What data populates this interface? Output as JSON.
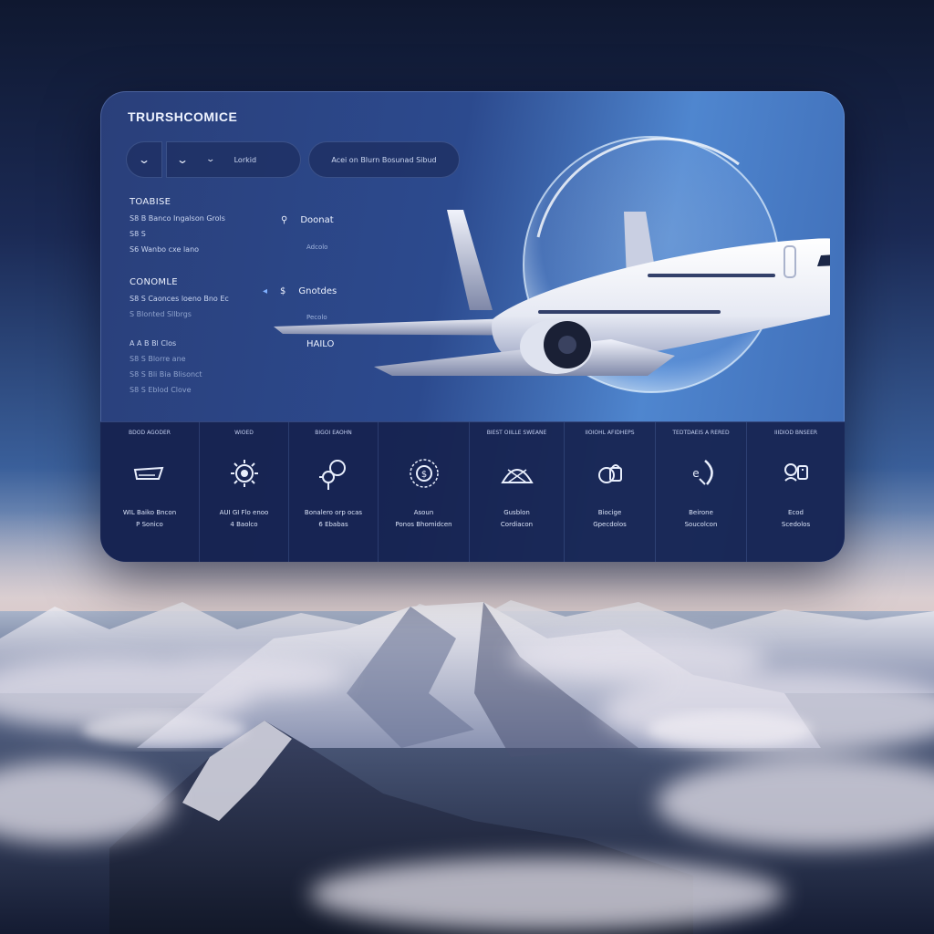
{
  "app": {
    "title": "TRURSHCOMICE"
  },
  "toolbar": {
    "chevrons": [
      "chevron-down-icon",
      "chevron-down-icon",
      "chevron-down-icon"
    ],
    "segment_label": "Lorkid",
    "search_text": "Acei on Blurn Bosunad Sibud"
  },
  "left": {
    "section1": {
      "title": "TOABISE",
      "rows": [
        "S8 B  Banco Ingalson Grols",
        "S8 S",
        "S6 Wanbo cxe lano"
      ]
    },
    "section2": {
      "title": "CONOMLE",
      "rows": [
        "S8 S  Caonces loeno Bno Ec",
        "S  Blonted Sllbrgs"
      ]
    },
    "section3": {
      "rows": [
        "A A B  Bl Clos",
        "S8 S  Blorre ane",
        "S8 S  Bli Bia Blisonct",
        "S8 S  Eblod Clove"
      ]
    }
  },
  "middle": {
    "items": [
      {
        "icon": "pin-icon",
        "label": "Doonat",
        "sub": "Adcolo"
      },
      {
        "icon": "s-icon",
        "label": "Gnotdes",
        "sub": "Pecolo"
      },
      {
        "icon": "slash-icon",
        "label": "HAILO",
        "sub": ""
      }
    ]
  },
  "cards": [
    {
      "top": "BDOD AGODER",
      "icon": "plane-wing-icon",
      "l1": "WIL Baiko Bncon",
      "l2": "P Sonico"
    },
    {
      "top": "WIOED",
      "icon": "sun-gear-icon",
      "l1": "AUI GI Flo enoo",
      "l2": "4 Baolco"
    },
    {
      "top": "BIGOI EAOHN",
      "icon": "person-globe-icon",
      "l1": "Bonalero orp ocas",
      "l2": "6 Ebabas"
    },
    {
      "top": "",
      "icon": "globe-icon",
      "l1": "Asoun",
      "l2": "Ponos Bhomidcen"
    },
    {
      "top": "BIEST OIILLE SWEANE",
      "icon": "tent-icon",
      "l1": "Gusblon",
      "l2": "Cordiacon"
    },
    {
      "top": "IIOIOHL AFIDHEPS",
      "icon": "bag-icon",
      "l1": "Biocige",
      "l2": "Gpecdolos"
    },
    {
      "top": "TEDTDAEIS A RERED",
      "icon": "headset-icon",
      "l1": "Beirone",
      "l2": "Soucolcon"
    },
    {
      "top": "IIIDIOD BNSEER",
      "icon": "support-icon",
      "l1": "Ecod",
      "l2": "Scedolos"
    }
  ],
  "colors": {
    "panel": "#2c4a8e",
    "accent": "#6fa6ff",
    "cards_bg": "#16224e"
  }
}
